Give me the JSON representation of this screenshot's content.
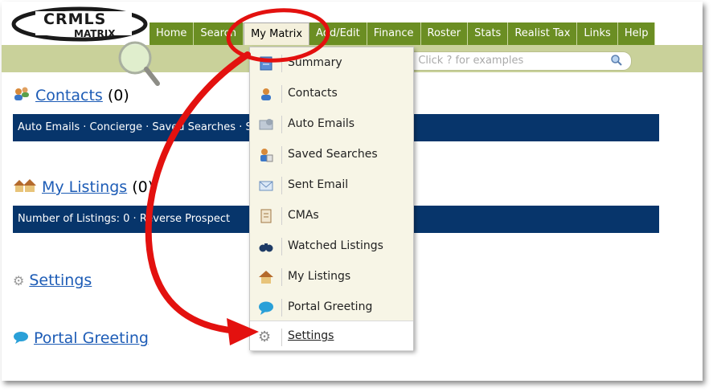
{
  "logo": {
    "line1": "CRMLS",
    "line2": "MATRIX"
  },
  "nav": [
    {
      "label": "Home"
    },
    {
      "label": "Search"
    },
    {
      "label": "My Matrix"
    },
    {
      "label": "Add/Edit"
    },
    {
      "label": "Finance"
    },
    {
      "label": "Roster"
    },
    {
      "label": "Stats"
    },
    {
      "label": "Realist Tax"
    },
    {
      "label": "Links"
    },
    {
      "label": "Help"
    }
  ],
  "search": {
    "hint": "! Click ? for examples"
  },
  "sections": {
    "contacts": {
      "title": "Contacts",
      "count": "(0)",
      "bar": "Auto Emails · Concierge · Saved Searches · Sent Email · Watched Listings"
    },
    "listings": {
      "title": "My Listings",
      "count": "(0)",
      "bar": "Number of Listings: 0 · Reverse Prospect"
    },
    "settings": {
      "title": "Settings"
    },
    "portal": {
      "title": "Portal Greeting"
    }
  },
  "menu": [
    {
      "label": "Summary",
      "icon": "summary-icon"
    },
    {
      "label": "Contacts",
      "icon": "contacts-icon"
    },
    {
      "label": "Auto Emails",
      "icon": "auto-emails-icon"
    },
    {
      "label": "Saved Searches",
      "icon": "saved-searches-icon"
    },
    {
      "label": "Sent Email",
      "icon": "envelope-icon"
    },
    {
      "label": "CMAs",
      "icon": "cma-icon"
    },
    {
      "label": "Watched Listings",
      "icon": "binoculars-icon"
    },
    {
      "label": "My Listings",
      "icon": "house-icon"
    },
    {
      "label": "Portal Greeting",
      "icon": "speech-bubble-icon"
    },
    {
      "label": "Settings",
      "icon": "gear-icon"
    }
  ],
  "colors": {
    "nav": "#6b8e23",
    "bar": "#07356b",
    "link": "#1d5cb6",
    "annotation": "#e3110f"
  }
}
